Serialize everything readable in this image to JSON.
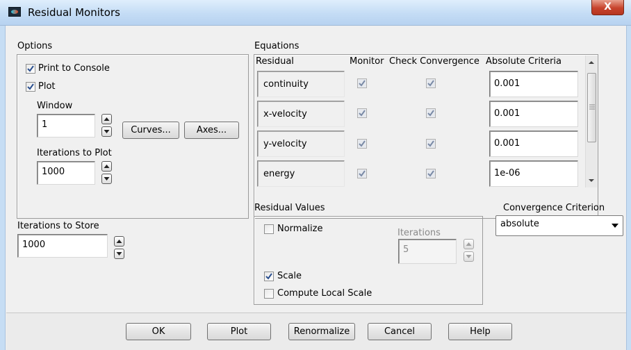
{
  "window": {
    "title": "Residual Monitors",
    "close_glyph": "X"
  },
  "options": {
    "title": "Options",
    "print_to_console": {
      "label": "Print to Console",
      "checked": true
    },
    "plot": {
      "label": "Plot",
      "checked": true
    },
    "window_label": "Window",
    "window_value": "1",
    "curves_button": "Curves...",
    "axes_button": "Axes...",
    "iterations_to_plot_label": "Iterations to Plot",
    "iterations_to_plot_value": "1000"
  },
  "store": {
    "label": "Iterations to Store",
    "value": "1000"
  },
  "equations": {
    "title": "Equations",
    "headers": {
      "residual": "Residual",
      "monitor": "Monitor",
      "check": "Check Convergence",
      "absolute": "Absolute Criteria"
    },
    "rows": [
      {
        "name": "continuity",
        "monitor": true,
        "check": true,
        "criteria": "0.001"
      },
      {
        "name": "x-velocity",
        "monitor": true,
        "check": true,
        "criteria": "0.001"
      },
      {
        "name": "y-velocity",
        "monitor": true,
        "check": true,
        "criteria": "0.001"
      },
      {
        "name": "energy",
        "monitor": true,
        "check": true,
        "criteria": "1e-06"
      }
    ]
  },
  "residual_values": {
    "title": "Residual Values",
    "normalize": {
      "label": "Normalize",
      "checked": false
    },
    "iterations_label": "Iterations",
    "iterations_value": "5",
    "scale": {
      "label": "Scale",
      "checked": true
    },
    "compute_local_scale": {
      "label": "Compute Local Scale",
      "checked": false
    }
  },
  "convergence": {
    "label": "Convergence Criterion",
    "selected": "absolute"
  },
  "buttons": {
    "ok": "OK",
    "plot": "Plot",
    "renormalize": "Renormalize",
    "cancel": "Cancel",
    "help": "Help"
  },
  "colors": {
    "titlebar": "#c4dcf5",
    "close": "#c7432c",
    "check": "#2a4f8f"
  }
}
